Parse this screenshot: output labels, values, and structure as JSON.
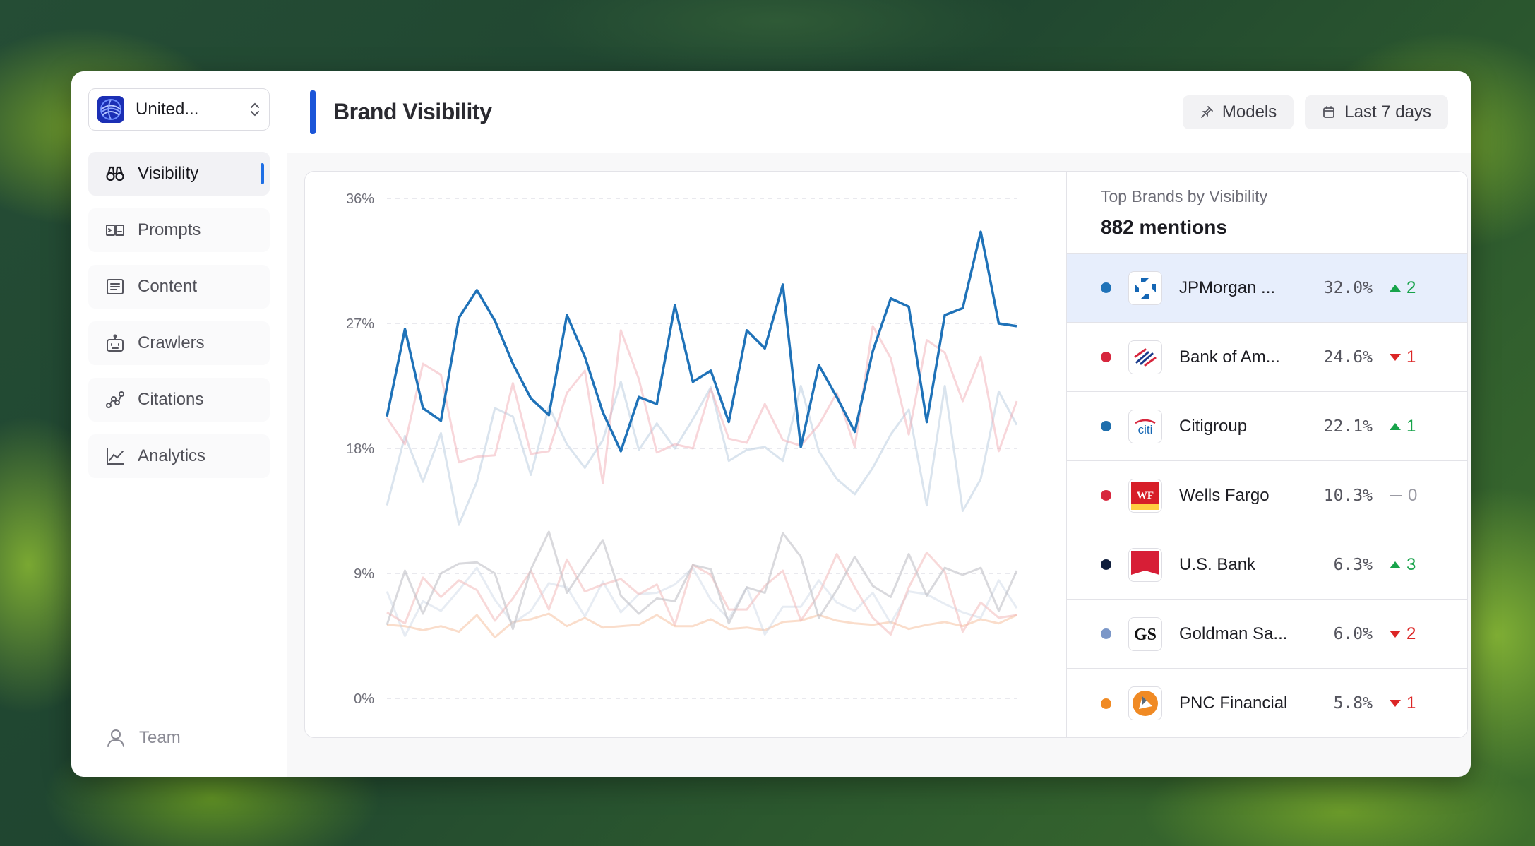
{
  "sidebar": {
    "org_name": "United...",
    "nav": [
      {
        "label": "Visibility",
        "icon": "binoculars-icon",
        "active": true
      },
      {
        "label": "Prompts",
        "icon": "prompts-icon",
        "active": false
      },
      {
        "label": "Content",
        "icon": "document-icon",
        "active": false
      },
      {
        "label": "Crawlers",
        "icon": "robot-icon",
        "active": false
      },
      {
        "label": "Citations",
        "icon": "citations-icon",
        "active": false
      },
      {
        "label": "Analytics",
        "icon": "line-chart-icon",
        "active": false
      }
    ],
    "team_label": "Team"
  },
  "header": {
    "title": "Brand Visibility",
    "models_label": "Models",
    "range_label": "Last 7 days"
  },
  "panel": {
    "subtitle": "Top Brands by Visibility",
    "total": "882 mentions",
    "brands": [
      {
        "name": "JPMorgan ...",
        "pct": "32.0%",
        "dir": "up",
        "change": "2",
        "color": "#1f72b8",
        "selected": true
      },
      {
        "name": "Bank of Am...",
        "pct": "24.6%",
        "dir": "down",
        "change": "1",
        "color": "#d7263d",
        "selected": false
      },
      {
        "name": "Citigroup",
        "pct": "22.1%",
        "dir": "up",
        "change": "1",
        "color": "#1f6fad",
        "selected": false
      },
      {
        "name": "Wells Fargo",
        "pct": "10.3%",
        "dir": "flat",
        "change": "0",
        "color": "#d7263d",
        "selected": false
      },
      {
        "name": "U.S. Bank",
        "pct": "6.3%",
        "dir": "up",
        "change": "3",
        "color": "#0f1e3c",
        "selected": false
      },
      {
        "name": "Goldman Sa...",
        "pct": "6.0%",
        "dir": "down",
        "change": "2",
        "color": "#7b97c8",
        "selected": false
      },
      {
        "name": "PNC Financial",
        "pct": "5.8%",
        "dir": "down",
        "change": "1",
        "color": "#f08a24",
        "selected": false
      }
    ]
  },
  "chart_data": {
    "type": "line",
    "y_ticks": [
      "36%",
      "27%",
      "18%",
      "9%",
      "0%"
    ],
    "ylim": [
      0,
      36
    ],
    "grid": true,
    "series": [
      {
        "color": "#1f72b8",
        "opacity": 1,
        "width": 3.5,
        "values": [
          20.3,
          26.6,
          20.9,
          20.0,
          27.4,
          29.4,
          27.2,
          24.1,
          21.6,
          20.4,
          27.6,
          24.6,
          20.6,
          17.8,
          21.7,
          21.2,
          28.3,
          22.8,
          23.6,
          19.9,
          26.5,
          25.2,
          29.8,
          18.1,
          24.0,
          21.7,
          19.2,
          25.0,
          28.8,
          28.2,
          19.9,
          27.6,
          28.1,
          33.6,
          27.0,
          26.8
        ]
      },
      {
        "color": "#f0a3ad",
        "opacity": 0.45,
        "width": 3,
        "values": [
          20.2,
          18.3,
          24.1,
          23.3,
          17.0,
          17.4,
          17.5,
          22.7,
          17.6,
          17.8,
          22.0,
          23.6,
          15.5,
          26.5,
          23.0,
          17.7,
          18.3,
          18.0,
          22.3,
          18.7,
          18.4,
          21.2,
          18.6,
          18.2,
          19.7,
          22.0,
          18.1,
          26.8,
          24.5,
          19.0,
          25.8,
          24.9,
          21.4,
          24.6,
          17.8,
          21.4
        ]
      },
      {
        "color": "#b6c9de",
        "opacity": 0.5,
        "width": 3,
        "values": [
          13.9,
          18.9,
          15.6,
          19.1,
          12.5,
          15.6,
          20.9,
          20.3,
          16.1,
          21.0,
          18.3,
          16.6,
          18.6,
          22.8,
          17.9,
          19.8,
          18.0,
          20.1,
          22.4,
          17.1,
          17.9,
          18.1,
          17.1,
          22.5,
          17.8,
          15.8,
          14.7,
          16.6,
          19.0,
          20.8,
          13.9,
          22.5,
          13.5,
          15.8,
          22.1,
          19.7
        ]
      },
      {
        "color": "#bfbfc7",
        "opacity": 0.6,
        "width": 3,
        "values": [
          5.3,
          9.2,
          6.1,
          9.0,
          9.7,
          9.8,
          9.0,
          5.0,
          9.3,
          12.0,
          7.6,
          9.5,
          11.4,
          7.4,
          6.1,
          7.2,
          7.0,
          9.6,
          9.3,
          5.4,
          8.0,
          7.6,
          11.9,
          10.2,
          5.8,
          7.8,
          10.2,
          8.1,
          7.3,
          10.4,
          7.4,
          9.4,
          8.9,
          9.4,
          6.3,
          9.2
        ]
      },
      {
        "color": "#f2b3b3",
        "opacity": 0.5,
        "width": 3,
        "values": [
          6.2,
          5.4,
          8.7,
          7.3,
          8.5,
          7.8,
          5.6,
          7.2,
          9.2,
          6.4,
          10.0,
          7.7,
          8.2,
          8.6,
          7.5,
          8.2,
          5.3,
          9.6,
          8.9,
          6.4,
          6.4,
          8.1,
          9.2,
          5.6,
          7.5,
          10.4,
          8.0,
          5.8,
          4.6,
          8.0,
          10.5,
          9.1,
          4.8,
          6.9,
          5.8,
          6.0
        ]
      },
      {
        "color": "#c9d4e4",
        "opacity": 0.45,
        "width": 3,
        "values": [
          7.7,
          4.5,
          7.0,
          6.3,
          7.8,
          9.4,
          7.1,
          5.4,
          6.3,
          8.3,
          8.0,
          5.9,
          8.4,
          6.2,
          7.5,
          7.6,
          8.2,
          9.4,
          7.1,
          5.7,
          8.0,
          4.6,
          6.6,
          6.6,
          8.5,
          6.9,
          6.3,
          7.6,
          5.4,
          7.7,
          7.5,
          6.8,
          6.2,
          5.8,
          8.5,
          6.5
        ]
      },
      {
        "color": "#f7c6a8",
        "opacity": 0.6,
        "width": 3,
        "values": [
          5.3,
          5.2,
          4.9,
          5.2,
          4.8,
          6.0,
          4.4,
          5.5,
          5.7,
          6.1,
          5.2,
          5.8,
          5.1,
          5.2,
          5.3,
          6.0,
          5.2,
          5.2,
          5.7,
          5.0,
          5.1,
          4.9,
          5.5,
          5.6,
          6.0,
          5.6,
          5.4,
          5.3,
          5.5,
          5.0,
          5.3,
          5.5,
          5.2,
          5.7,
          5.4,
          6.0
        ]
      }
    ]
  }
}
